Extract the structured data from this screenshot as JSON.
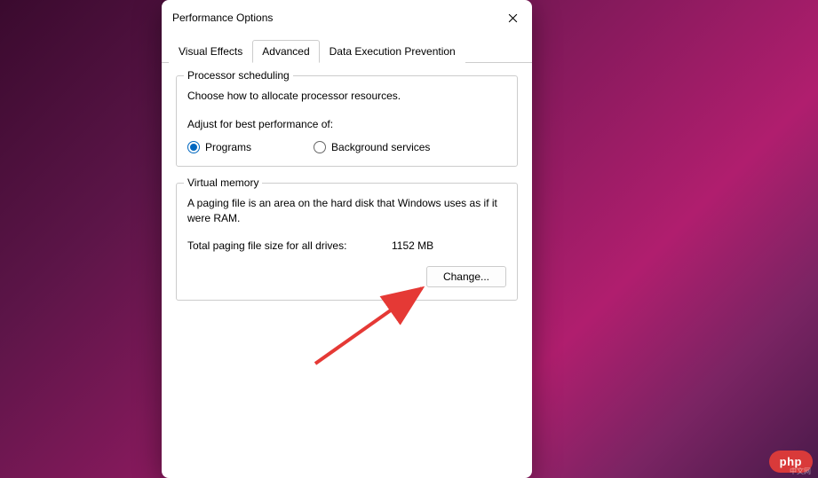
{
  "dialog": {
    "title": "Performance Options",
    "tabs": [
      {
        "label": "Visual Effects",
        "active": false
      },
      {
        "label": "Advanced",
        "active": true
      },
      {
        "label": "Data Execution Prevention",
        "active": false
      }
    ]
  },
  "processor": {
    "legend": "Processor scheduling",
    "description": "Choose how to allocate processor resources.",
    "adjust_label": "Adjust for best performance of:",
    "options": {
      "programs": "Programs",
      "background": "Background services"
    }
  },
  "virtual_memory": {
    "legend": "Virtual memory",
    "description": "A paging file is an area on the hard disk that Windows uses as if it were RAM.",
    "total_label": "Total paging file size for all drives:",
    "total_value": "1152 MB",
    "change_button": "Change..."
  },
  "watermark": {
    "brand": "php",
    "sub": "中文网"
  }
}
